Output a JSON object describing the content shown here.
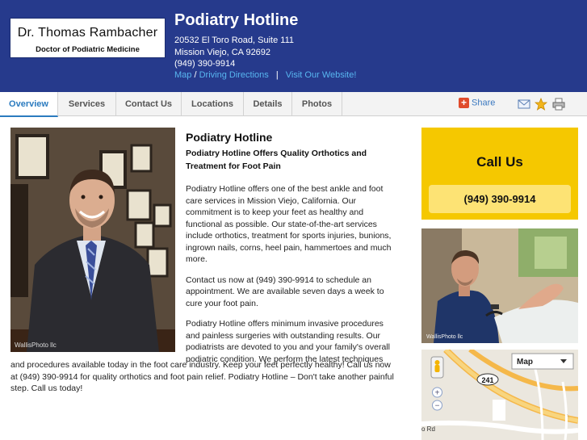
{
  "header": {
    "logo_name": "Dr. Thomas Rambacher",
    "logo_subtitle": "Doctor of Podiatric Medicine",
    "business_name": "Podiatry Hotline",
    "address_line1": "20532 El Toro Road, Suite 111",
    "address_line2": "Mission Viejo, CA 92692",
    "phone": "(949) 390-9914",
    "link_map": "Map",
    "link_separator": "/",
    "link_directions": "Driving Directions",
    "link_divider": "|",
    "link_website": "Visit Our Website!"
  },
  "nav": {
    "tabs": [
      {
        "label": "Overview",
        "active": true
      },
      {
        "label": "Services"
      },
      {
        "label": "Contact Us"
      },
      {
        "label": "Locations"
      },
      {
        "label": "Details"
      },
      {
        "label": "Photos"
      }
    ],
    "share_label": "Share",
    "icons": [
      "email-icon",
      "star-icon",
      "print-icon"
    ]
  },
  "main": {
    "title": "Podiatry Hotline",
    "subtitle": "Podiatry Hotline Offers Quality Orthotics and Treatment for Foot Pain",
    "paragraph1": "Podiatry Hotline offers one of the best ankle and foot care services in Mission Viejo, California. Our commitment is to keep your feet as healthy and functional as possible. Our state-of-the-art services include orthotics, treatment for sports injuries, bunions, ingrown nails, corns, heel pain, hammertoes and much more.",
    "paragraph2": "Contact us now at (949) 390-9914 to schedule an appointment. We are available seven days a week to cure your foot pain.",
    "paragraph3_part1": "Podiatry Hotline offers minimum invasive procedures and painless surgeries with outstanding results. Our podiatrists are devoted to you and your family's overall podiatric condition. We perform the latest techniques",
    "paragraph3_part2": "and procedures available today in the foot care industry. Keep your feet perfectly healthy! Call us now at (949) 390-9914 for quality orthotics and foot pain relief. Podiatry Hotline – Don't take another painful step. Call us today!",
    "photo_watermark": "WallisPhoto llc"
  },
  "sidebar": {
    "call_title": "Call Us",
    "call_phone": "(949) 390-9914",
    "photo_watermark": "WallisPhoto llc",
    "map_type_label": "Map",
    "map_route": "241",
    "map_road_label": "o Rd",
    "zoom_in": "+",
    "zoom_out": "−"
  },
  "colors": {
    "header_bg": "#263a8c",
    "link": "#58b6f0",
    "active_tab": "#2b7bbf",
    "call_box": "#f5c800",
    "call_button": "#fde374"
  }
}
